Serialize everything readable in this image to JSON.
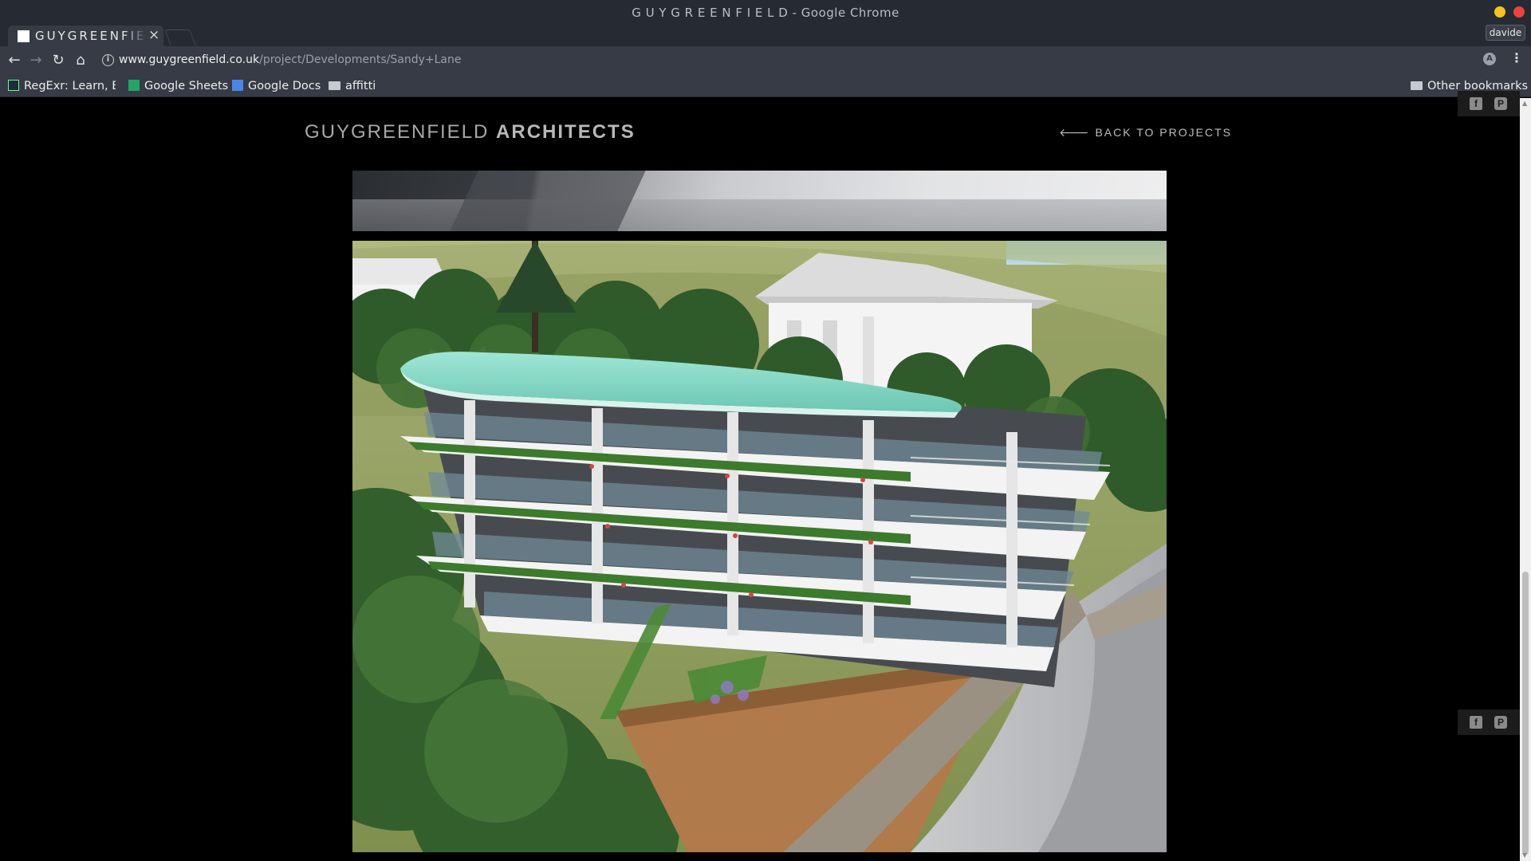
{
  "window": {
    "title": "G U Y G R E E N F I E L D - Google Chrome",
    "profile": "davide"
  },
  "tab": {
    "title": "GUYGREENFIELD",
    "close": "×"
  },
  "toolbar": {
    "back": "←",
    "forward": "→",
    "reload": "↻",
    "home": "⌂",
    "url_host": "www.guygreenfield.co.uk",
    "url_path": "/project/Developments/Sandy+Lane",
    "star": "☆",
    "extension": "A",
    "menu": "⋮"
  },
  "bookmarks": {
    "items": [
      {
        "label": "RegExr: Learn, Bu",
        "icon": "regexr-icon"
      },
      {
        "label": "Google Sheets",
        "icon": "sheets-icon"
      },
      {
        "label": "Google Docs",
        "icon": "docs-icon"
      },
      {
        "label": "affitti",
        "icon": "folder-icon"
      }
    ],
    "other": "Other bookmarks"
  },
  "page": {
    "brand_light": "GUYGREENFIELD",
    "brand_bold": "ARCHITECTS",
    "back_link": "BACK TO PROJECTS",
    "back_arrow": "🡐"
  },
  "social": {
    "facebook": "f",
    "pinterest": "P"
  },
  "colors": {
    "chrome_bg": "#252a33",
    "toolbar_bg": "#363b45",
    "page_bg": "#000000",
    "roof_teal": "#7fd8c4"
  }
}
